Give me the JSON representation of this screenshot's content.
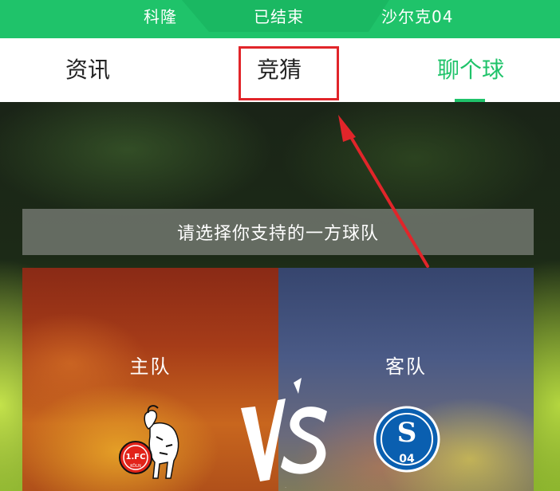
{
  "header": {
    "home_team": "科隆",
    "match_status": "已结束",
    "away_team": "沙尔克04"
  },
  "tabs": {
    "news": "资讯",
    "guess": "竞猜",
    "chat": "聊个球",
    "active": "chat"
  },
  "guess": {
    "prompt": "请选择你支持的一方球队",
    "home_label": "主队",
    "away_label": "客队",
    "vs_text": "VS"
  },
  "crests": {
    "home_text": "1.FC",
    "home_subtext": "KÖLN",
    "away_letter": "S",
    "away_number": "04"
  },
  "colors": {
    "brand_green": "#1fc36a",
    "annotation_red": "#e1252a",
    "home_panel": "#a63c18",
    "away_panel": "#4a5a86"
  },
  "icons": {
    "home_crest": "koln-goat-crest-icon",
    "away_crest": "schalke-crest-icon",
    "versus": "vs-brush-icon",
    "annotation": "red-arrow-icon"
  }
}
